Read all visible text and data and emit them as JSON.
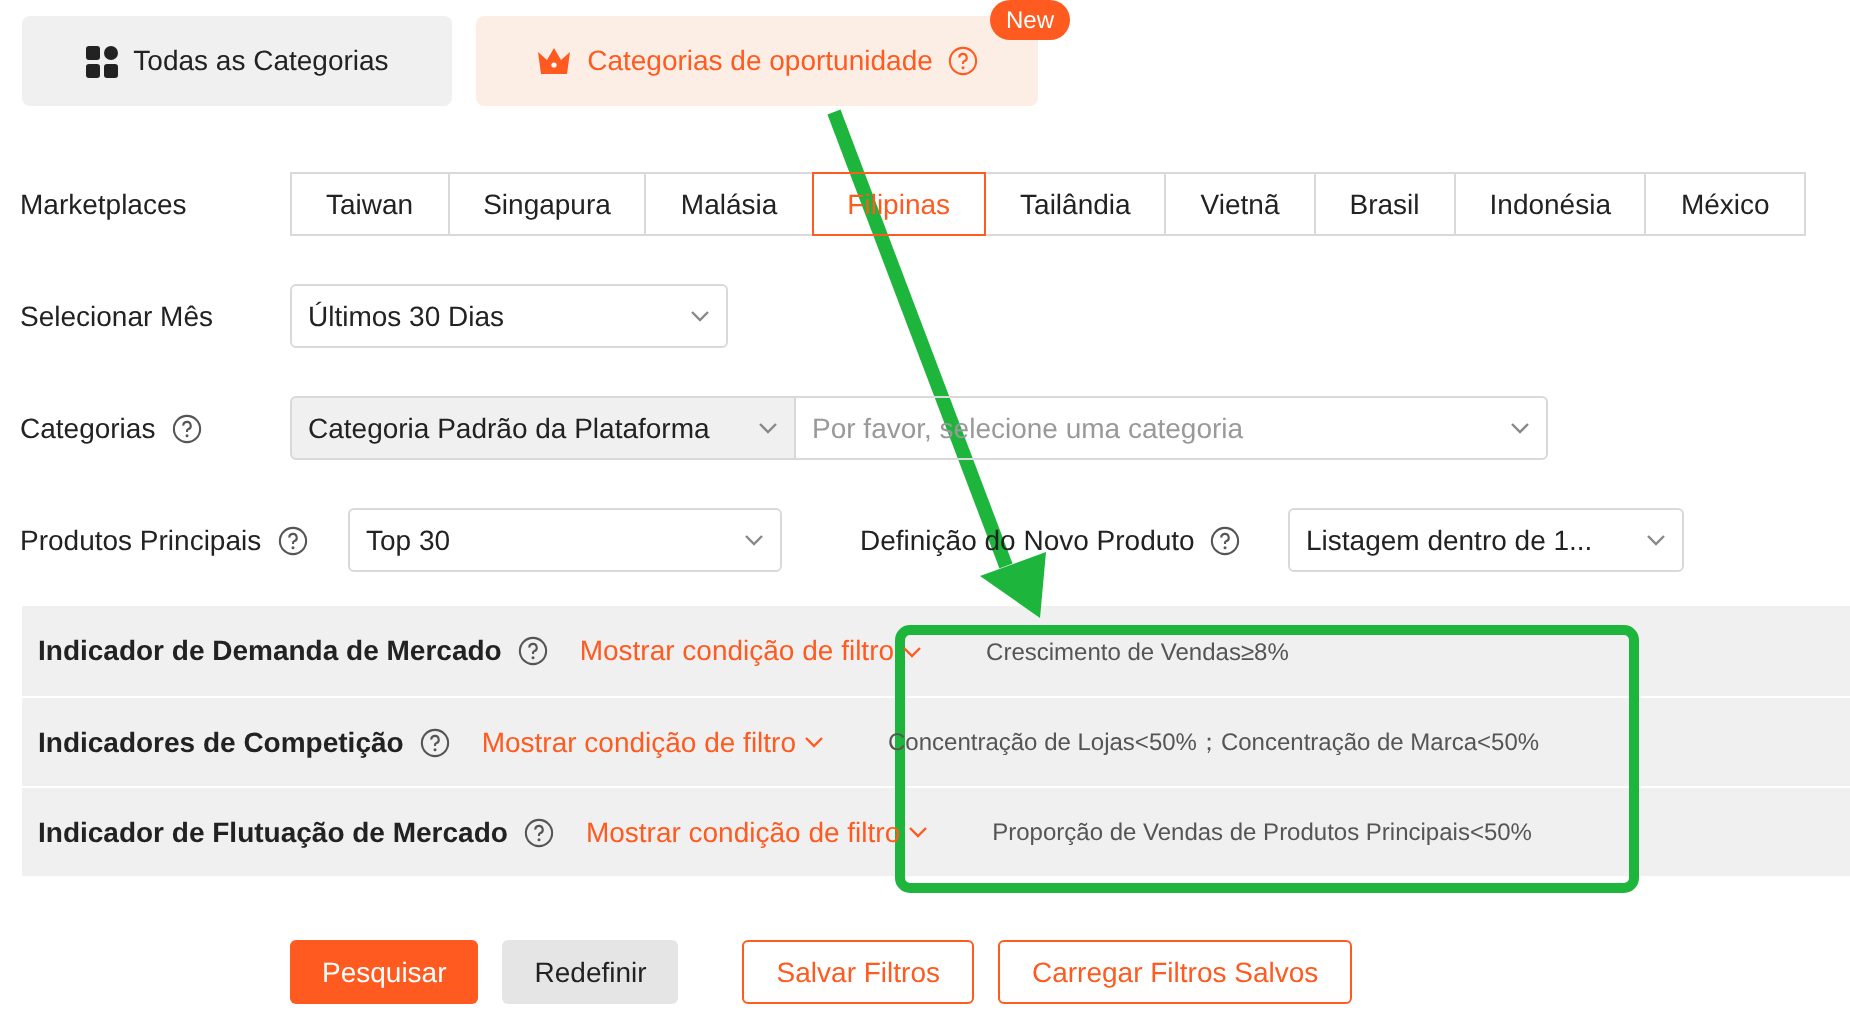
{
  "category_tabs": [
    {
      "label": "Todas as Categorias",
      "kind": "grid",
      "selected": false
    },
    {
      "label": "Categorias de oportunidade",
      "kind": "crown",
      "selected": true,
      "badge": "New",
      "help": true
    }
  ],
  "marketplaces": {
    "label": "Marketplaces",
    "options": [
      {
        "label": "Taiwan",
        "selected": false
      },
      {
        "label": "Singapura",
        "selected": false
      },
      {
        "label": "Malásia",
        "selected": false
      },
      {
        "label": "Filipinas",
        "selected": true
      },
      {
        "label": "Tailândia",
        "selected": false
      },
      {
        "label": "Vietnã",
        "selected": false
      },
      {
        "label": "Brasil",
        "selected": false
      },
      {
        "label": "Indonésia",
        "selected": false
      },
      {
        "label": "México",
        "selected": false
      }
    ]
  },
  "month": {
    "label": "Selecionar Mês",
    "value": "Últimos 30 Dias"
  },
  "categories": {
    "label": "Categorias",
    "source_value": "Categoria Padrão da Plataforma",
    "placeholder": "Por favor, selecione uma categoria"
  },
  "top_products": {
    "label": "Produtos Principais",
    "value": "Top 30"
  },
  "new_product": {
    "label": "Definição do Novo Produto",
    "value": "Listagem dentro de 1..."
  },
  "indicators": [
    {
      "title": "Indicador de Demanda de Mercado",
      "toggle": "Mostrar condição de filtro",
      "condition": "Crescimento de Vendas≥8%"
    },
    {
      "title": "Indicadores de Competição",
      "toggle": "Mostrar condição de filtro",
      "condition": "Concentração de Lojas<50%；Concentração de Marca<50%"
    },
    {
      "title": "Indicador de Flutuação de Mercado",
      "toggle": "Mostrar condição de filtro",
      "condition": "Proporção de Vendas de Produtos Principais<50%"
    }
  ],
  "buttons": [
    {
      "label": "Pesquisar",
      "kind": "primary"
    },
    {
      "label": "Redefinir",
      "kind": "secondary"
    },
    {
      "label": "Salvar Filtros",
      "kind": "outline"
    },
    {
      "label": "Carregar Filtros Salvos",
      "kind": "outline"
    }
  ]
}
